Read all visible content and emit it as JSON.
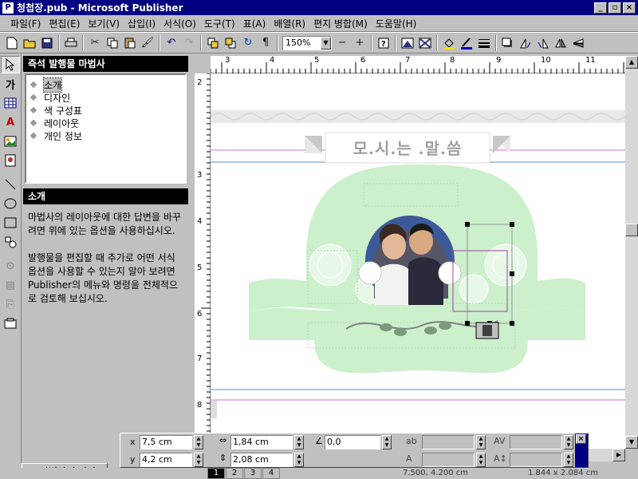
{
  "window": {
    "title": "청첩장.pub - Microsoft Publisher",
    "min": "_",
    "max": "▫",
    "close": "×"
  },
  "menu": [
    "파일(F)",
    "편집(E)",
    "보기(V)",
    "삽입(I)",
    "서식(O)",
    "도구(T)",
    "표(A)",
    "배열(R)",
    "편지 병합(M)",
    "도움말(H)"
  ],
  "toolbar": {
    "zoom": "150%",
    "zoom_minus": "−",
    "zoom_plus": "+"
  },
  "wizard": {
    "title": "즉석 발행물 마법사",
    "items": [
      "소개",
      "디자인",
      "색 구성표",
      "레이아웃",
      "개인 정보"
    ],
    "selected": 0,
    "section_title": "소개",
    "desc1": "마법사의 레이아웃에 대한 답변을 바꾸려면 위에 있는 옵션을 사용하십시오.",
    "desc2": "발행물을 편집할 때 추가로 어떤 서식 옵션을 사용할 수 있는지 알아 보려면 Publisher의 메뉴와 명령을 전체적으로 검토해 보십시오.",
    "hide_label": "마법사 숨기기"
  },
  "ruler": {
    "h": [
      "3",
      "4",
      "5",
      "6",
      "7",
      "8",
      "9",
      "10",
      "11"
    ],
    "v": [
      "2",
      "3",
      "4",
      "5",
      "6",
      "7",
      "8"
    ]
  },
  "document": {
    "heading": "모.시.는 .말.씀"
  },
  "measure": {
    "x_label": "x",
    "x": "7,5 cm",
    "y_label": "y",
    "y": "4,2 cm",
    "w": "1,84 cm",
    "h": "2,08 cm",
    "angle": "0,0"
  },
  "status": {
    "pages": [
      "1",
      "2",
      "3",
      "4"
    ],
    "current_page": 0,
    "position": "7.500, 4.200 cm",
    "size": "1.844 x 2.084 cm"
  }
}
